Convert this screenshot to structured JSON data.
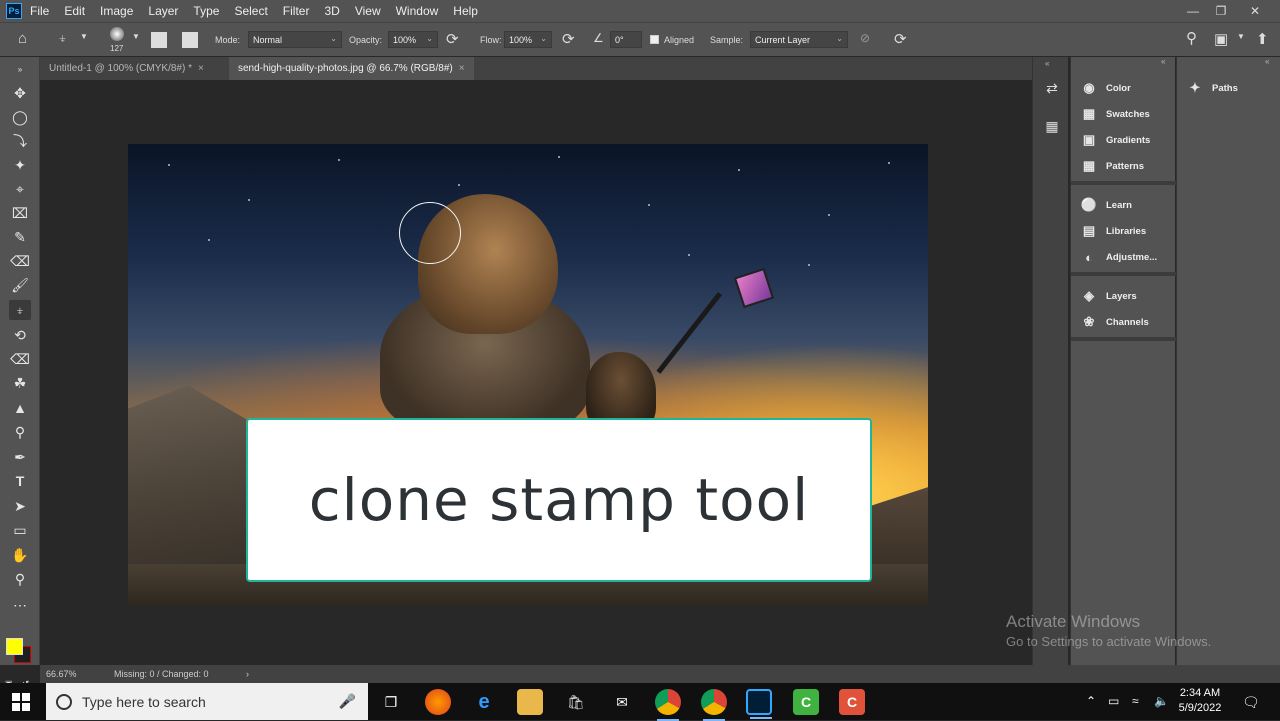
{
  "menubar": {
    "logo": "Ps",
    "items": [
      "File",
      "Edit",
      "Image",
      "Layer",
      "Type",
      "Select",
      "Filter",
      "3D",
      "View",
      "Window",
      "Help"
    ]
  },
  "options": {
    "brush_size": "127",
    "mode_label": "Mode:",
    "mode_value": "Normal",
    "opacity_label": "Opacity:",
    "opacity_value": "100%",
    "flow_label": "Flow:",
    "flow_value": "100%",
    "angle_value": "0°",
    "aligned_label": "Aligned",
    "sample_label": "Sample:",
    "sample_value": "Current Layer"
  },
  "tabs": [
    {
      "label": "Untitled-1 @ 100% (CMYK/8#) *",
      "active": false
    },
    {
      "label": "send-high-quality-photos.jpg @ 66.7% (RGB/8#)",
      "active": true
    }
  ],
  "caption": "clone stamp tool",
  "panels": {
    "group1": [
      "Color",
      "Swatches",
      "Gradients",
      "Patterns"
    ],
    "group2": [
      "Learn",
      "Libraries",
      "Adjustme..."
    ],
    "group3": [
      "Layers",
      "Channels"
    ],
    "paths": "Paths"
  },
  "watermark": {
    "title": "Activate Windows",
    "subtitle": "Go to Settings to activate Windows."
  },
  "status": {
    "zoom": "66.67%",
    "info": "Missing: 0 / Changed: 0"
  },
  "taskbar": {
    "search_placeholder": "Type here to search",
    "time": "2:34 AM",
    "date": "5/9/2022"
  },
  "colors": {
    "foreground": "#ffff00",
    "background": "#1e1e1e",
    "caption_border": "#1fb59a"
  }
}
